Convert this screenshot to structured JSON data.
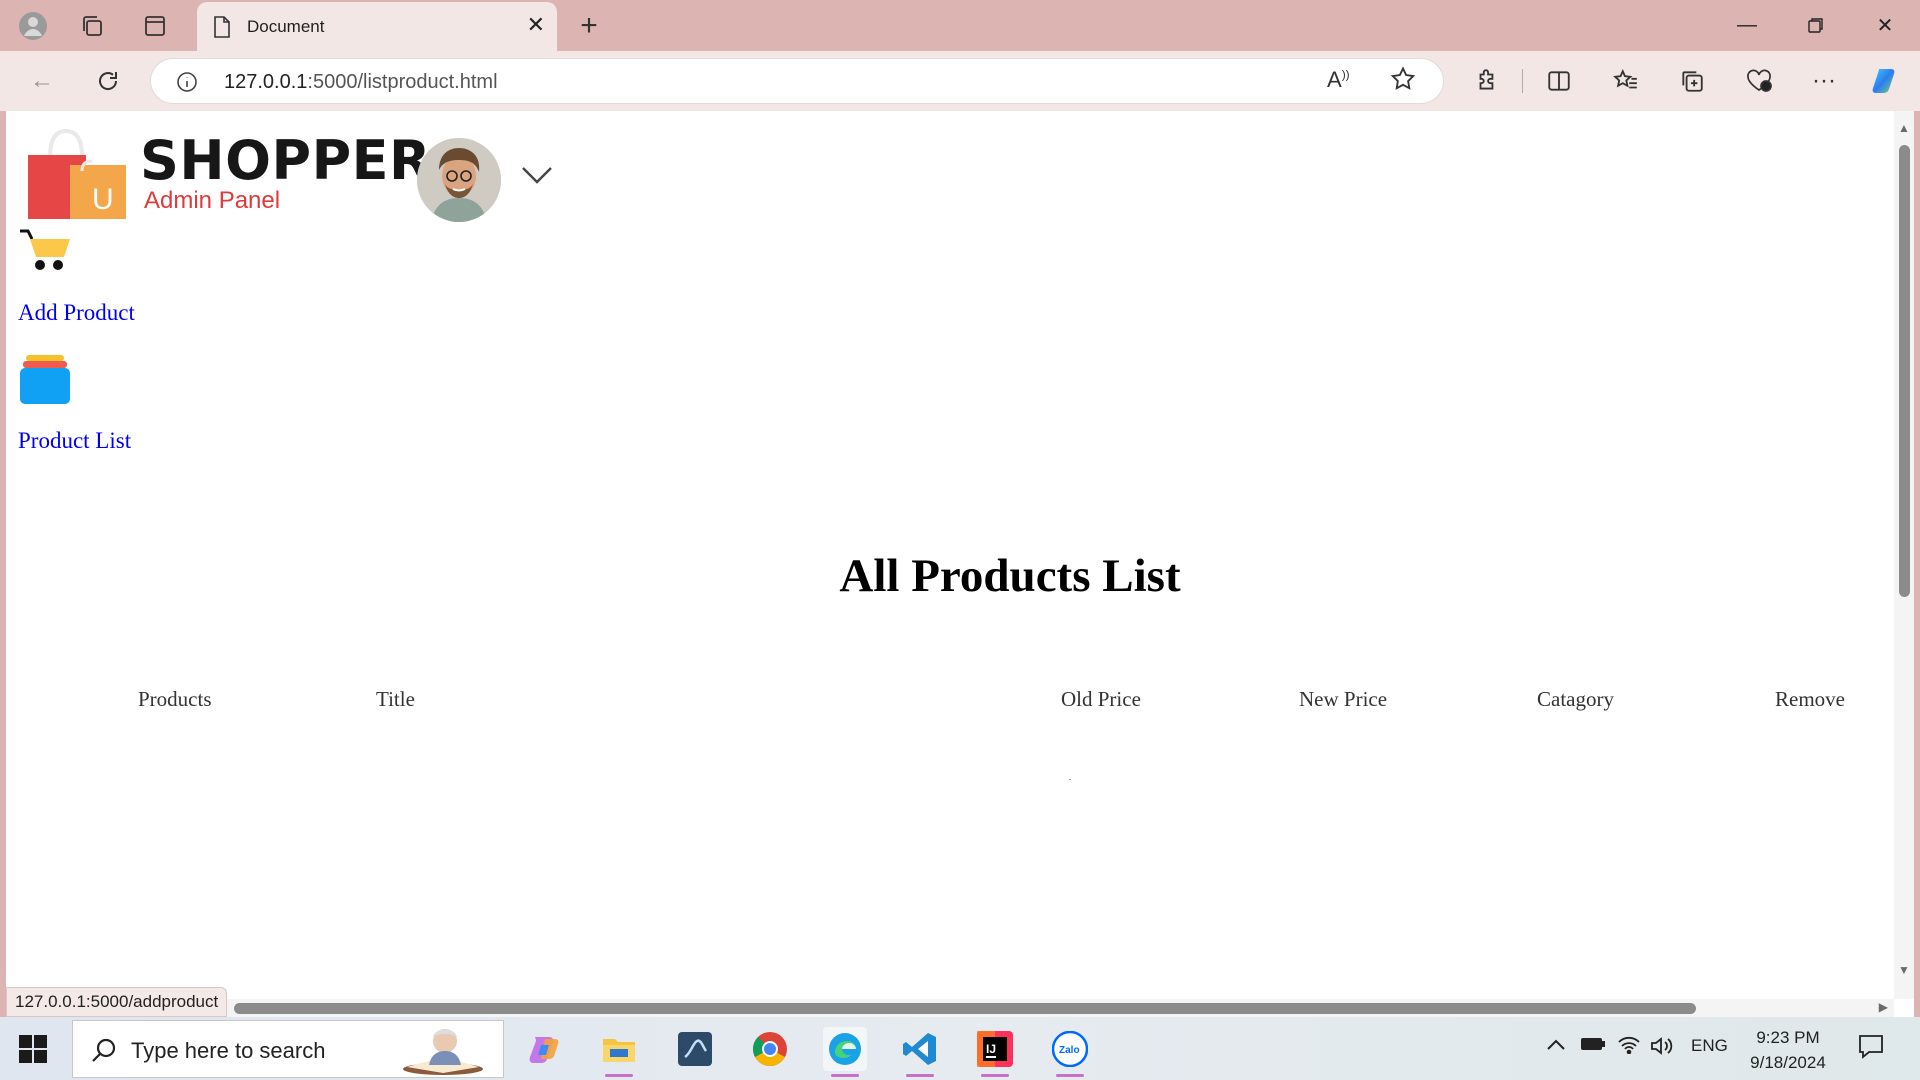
{
  "browser": {
    "tab_title": "Document",
    "url_host": "127.0.0.1",
    "url_rest": ":5000/listproduct.html",
    "status_url": "127.0.0.1:5000/addproduct"
  },
  "header": {
    "brand": "SHOPPER",
    "subtitle": "Admin Panel"
  },
  "sidebar": {
    "items": [
      {
        "label": "Add Product",
        "icon": "cart-icon"
      },
      {
        "label": "Product List",
        "icon": "list-icon"
      }
    ]
  },
  "main": {
    "title": "All Products List",
    "columns": [
      "Products",
      "Title",
      "Old Price",
      "New Price",
      "Catagory",
      "Remove"
    ]
  },
  "taskbar": {
    "search_placeholder": "Type here to search",
    "lang": "ENG",
    "time": "9:23 PM",
    "date": "9/18/2024"
  },
  "colors": {
    "accent": "#e03a3a",
    "link": "#0000ee",
    "chrome": "#dcb5b3"
  }
}
